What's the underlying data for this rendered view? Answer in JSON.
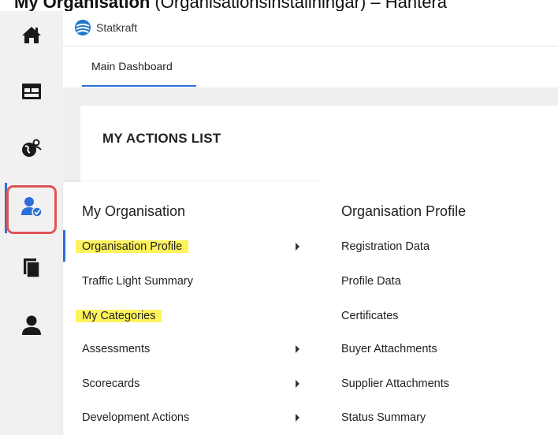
{
  "caption": {
    "bold": "My Organisation",
    "rest": " (Organisationsinställningar) – Hantera"
  },
  "header": {
    "logo_text": "Statkraft"
  },
  "tabs": [
    {
      "label": "Main Dashboard"
    }
  ],
  "card": {
    "title": "MY ACTIONS LIST"
  },
  "sidebar": {
    "icons": [
      "home-icon",
      "dashboard-icon",
      "globe-people-icon",
      "organisation-user-check-icon",
      "documents-icon",
      "user-icon"
    ],
    "active_index": 3
  },
  "menu": {
    "heading": "My Organisation",
    "items": [
      {
        "label": "Organisation Profile",
        "highlighted": true,
        "submenu": true
      },
      {
        "label": "Traffic Light Summary",
        "highlighted": false,
        "submenu": false
      },
      {
        "label": "My Categories",
        "highlighted": true,
        "submenu": false
      },
      {
        "label": "Assessments",
        "highlighted": false,
        "submenu": true
      },
      {
        "label": "Scorecards",
        "highlighted": false,
        "submenu": true
      },
      {
        "label": "Development Actions",
        "highlighted": false,
        "submenu": true
      }
    ]
  },
  "submenu": {
    "heading": "Organisation Profile",
    "items": [
      {
        "label": "Registration Data"
      },
      {
        "label": "Profile Data"
      },
      {
        "label": "Certificates"
      },
      {
        "label": "Buyer Attachments"
      },
      {
        "label": "Supplier Attachments"
      },
      {
        "label": "Status Summary"
      }
    ]
  },
  "colors": {
    "accent": "#2d6fd9",
    "highlight": "#fff35c",
    "alert_outline": "#e05454"
  }
}
